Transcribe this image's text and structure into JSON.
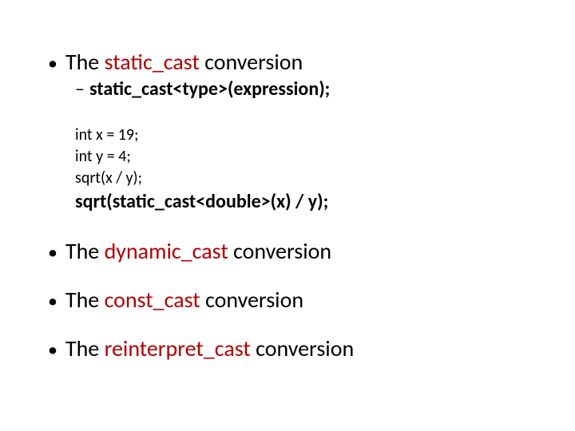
{
  "bullets": [
    {
      "prefix": "The ",
      "highlight": "static_cast",
      "suffix": " conversion"
    },
    {
      "prefix": "The ",
      "highlight": "dynamic_cast",
      "suffix": " conversion"
    },
    {
      "prefix": "The ",
      "highlight": "const_cast",
      "suffix": " conversion"
    },
    {
      "prefix": "The ",
      "highlight": "reinterpret_cast",
      "suffix": " conversion"
    }
  ],
  "sub": {
    "text": "static_cast<type>(expression);"
  },
  "code": {
    "lines": [
      "int x = 19;",
      "int y = 4;",
      "sqrt(x / y);"
    ],
    "bold_line": "sqrt(static_cast<double>(x) / y);"
  },
  "glyphs": {
    "bullet": "•",
    "dash": "–"
  }
}
